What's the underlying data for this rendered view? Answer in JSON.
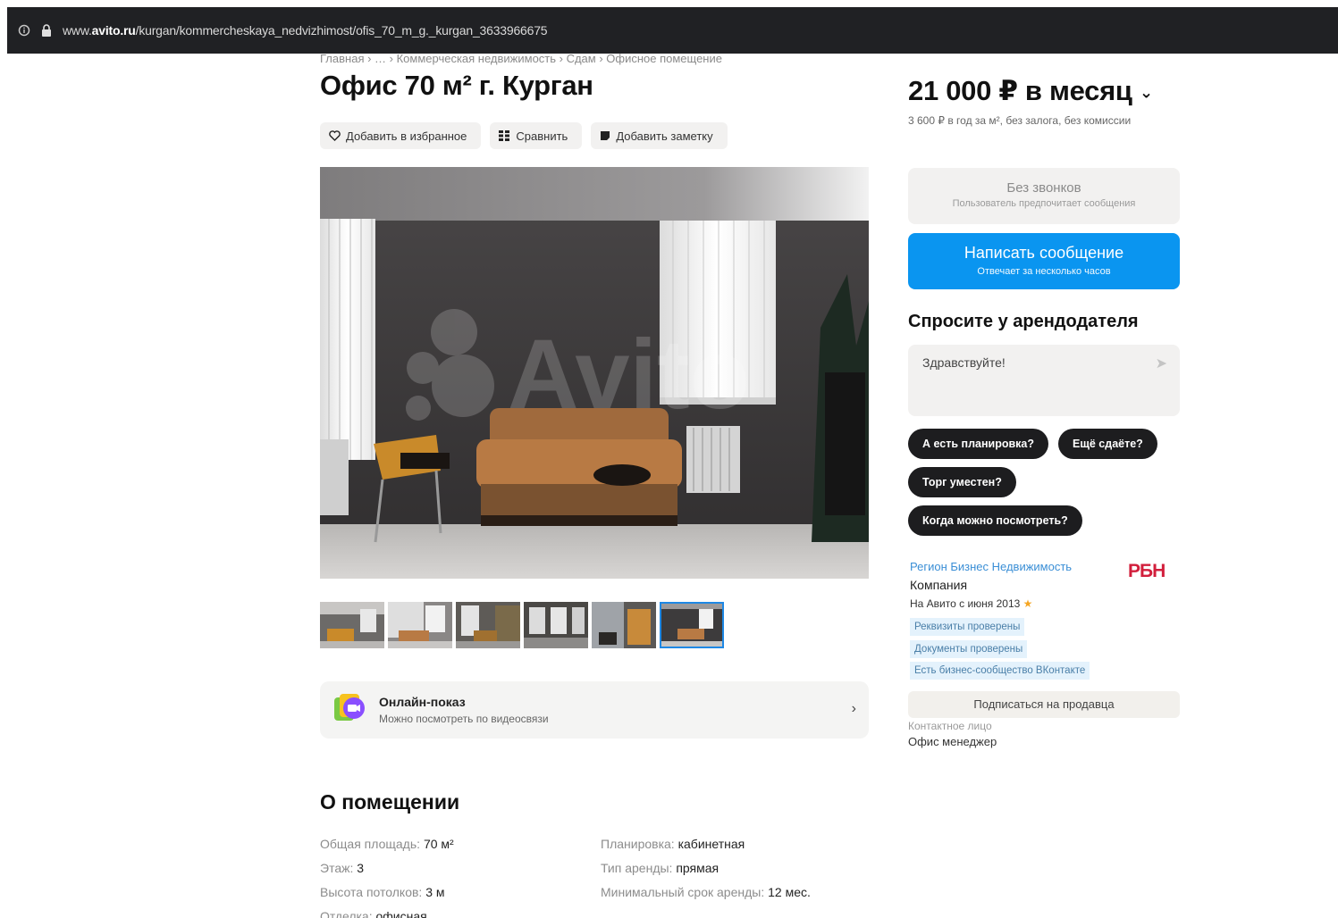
{
  "browser": {
    "url_prefix": "www.",
    "url_domain": "avito.ru",
    "url_path": "/kurgan/kommercheskaya_nedvizhimost/ofis_70_m_g._kurgan_3633966675"
  },
  "breadcrumb": "Главная › … › Коммерческая недвижимость › Сдам › Офисное помещение",
  "listing": {
    "title": "Офис 70 м² г. Курган",
    "actions": {
      "favorite": "Добавить в избранное",
      "compare": "Сравнить",
      "note": "Добавить заметку"
    },
    "thumbnails_count": 6,
    "active_thumbnail": 6,
    "online_show": {
      "title": "Онлайн-показ",
      "subtitle": "Можно посмотреть по видеосвязи"
    }
  },
  "about": {
    "title": "О помещении",
    "left": [
      {
        "key": "Общая площадь:",
        "value": "70 м²"
      },
      {
        "key": "Этаж:",
        "value": "3"
      },
      {
        "key": "Высота потолков:",
        "value": "3 м"
      },
      {
        "key": "Отделка:",
        "value": "офисная"
      }
    ],
    "right": [
      {
        "key": "Планировка:",
        "value": "кабинетная"
      },
      {
        "key": "Тип аренды:",
        "value": "прямая"
      },
      {
        "key": "Минимальный срок аренды:",
        "value": "12 мес."
      }
    ]
  },
  "sidebar": {
    "price": "21 000 ₽ в месяц",
    "price_sub": "3 600 ₽ в год за м², без залога, без комиссии",
    "no_calls": {
      "title": "Без звонков",
      "subtitle": "Пользователь предпочитает сообщения"
    },
    "write_button": {
      "title": "Написать сообщение",
      "subtitle": "Отвечает за несколько часов"
    },
    "ask_title": "Спросите у арендодателя",
    "ask_input": "Здравствуйте!",
    "chips": [
      "А есть планировка?",
      "Ещё сдаёте?",
      "Торг уместен?",
      "Когда можно посмотреть?"
    ],
    "seller": {
      "name": "Регион Бизнес Недвижимость",
      "type": "Компания",
      "since": "На Авито с июня 2013",
      "logo": "РБН",
      "badges": [
        "Реквизиты проверены",
        "Документы проверены",
        "Есть бизнес-сообщество ВКонтакте"
      ],
      "subscribe": "Подписаться на продавца",
      "contact_label": "Контактное лицо",
      "contact_name": "Офис менеджер"
    }
  },
  "colors": {
    "browser_bar": "#202124",
    "primary_button": "#0a95f0",
    "chip": "#1d1d1f",
    "seller_link": "#3b8fd6",
    "badge_bg": "#e4f2fc",
    "logo": "#d21f3c"
  }
}
